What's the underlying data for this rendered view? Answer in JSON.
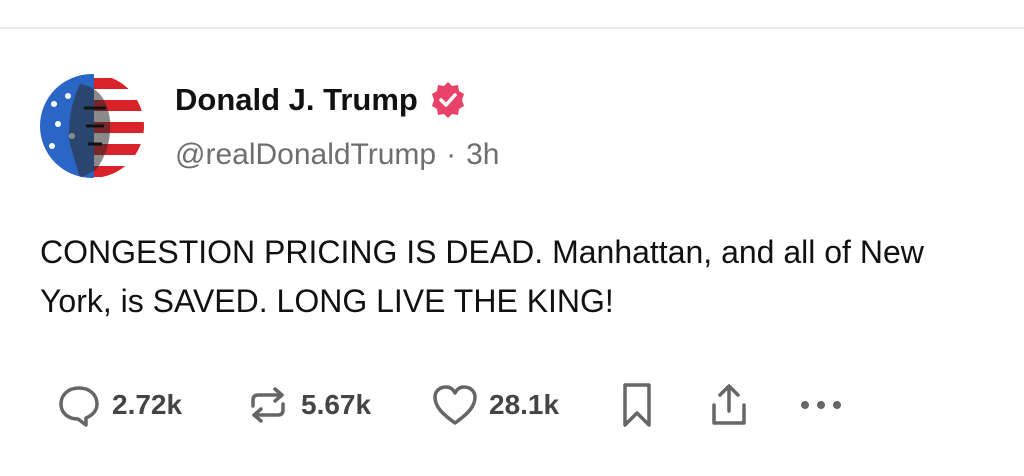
{
  "post": {
    "author": {
      "display_name": "Donald J. Trump",
      "handle": "@realDonaldTrump",
      "verified": true,
      "verified_color": "#e8416a"
    },
    "separator": "·",
    "timestamp": "3h",
    "text": "CONGESTION PRICING IS DEAD. Manhattan, and all of New York, is SAVED. LONG LIVE THE KING!",
    "actions": {
      "reply_count": "2.72k",
      "repost_count": "5.67k",
      "like_count": "28.1k"
    },
    "icons": [
      "reply-icon",
      "repost-icon",
      "like-icon",
      "bookmark-icon",
      "share-icon",
      "more-icon"
    ]
  }
}
